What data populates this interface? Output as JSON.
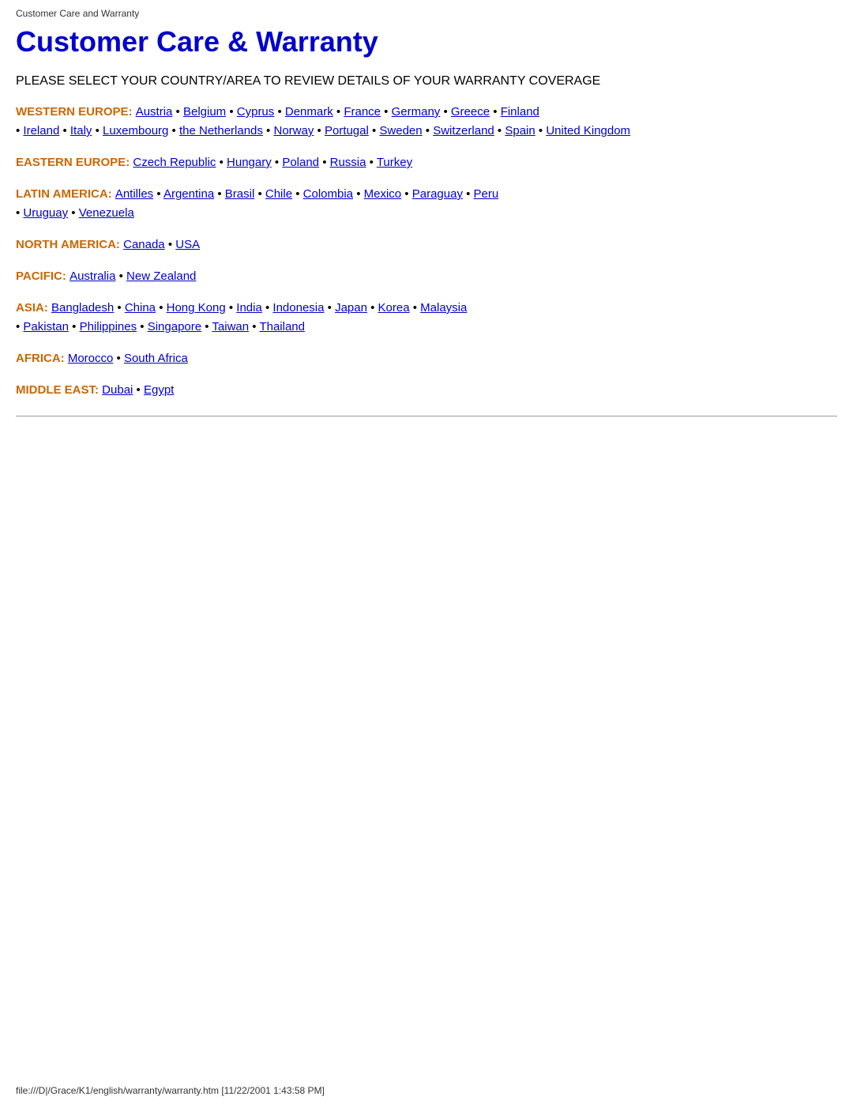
{
  "browser_tab": "Customer Care and Warranty",
  "page_title": "Customer Care & Warranty",
  "subtitle": "PLEASE SELECT YOUR COUNTRY/AREA TO REVIEW DETAILS OF YOUR WARRANTY COVERAGE",
  "regions": [
    {
      "id": "western-europe",
      "label": "WESTERN EUROPE:",
      "countries": [
        "Austria",
        "Belgium",
        "Cyprus",
        "Denmark",
        "France",
        "Germany",
        "Greece",
        "Finland",
        "Ireland",
        "Italy",
        "Luxembourg",
        "the Netherlands",
        "Norway",
        "Portugal",
        "Sweden",
        "Switzerland",
        "Spain",
        "United Kingdom"
      ]
    },
    {
      "id": "eastern-europe",
      "label": "EASTERN EUROPE:",
      "countries": [
        "Czech Republic",
        "Hungary",
        "Poland",
        "Russia",
        "Turkey"
      ]
    },
    {
      "id": "latin-america",
      "label": "LATIN AMERICA:",
      "countries": [
        "Antilles",
        "Argentina",
        "Brasil",
        "Chile",
        "Colombia",
        "Mexico",
        "Paraguay",
        "Peru",
        "Uruguay",
        "Venezuela"
      ]
    },
    {
      "id": "north-america",
      "label": "NORTH AMERICA:",
      "countries": [
        "Canada",
        "USA"
      ]
    },
    {
      "id": "pacific",
      "label": "PACIFIC:",
      "countries": [
        "Australia",
        "New Zealand"
      ]
    },
    {
      "id": "asia",
      "label": "ASIA:",
      "countries": [
        "Bangladesh",
        "China",
        "Hong Kong",
        "India",
        "Indonesia",
        "Japan",
        "Korea",
        "Malaysia",
        "Pakistan",
        "Philippines",
        "Singapore",
        "Taiwan",
        "Thailand"
      ]
    },
    {
      "id": "africa",
      "label": "AFRICA:",
      "countries": [
        "Morocco",
        "South Africa"
      ]
    },
    {
      "id": "middle-east",
      "label": "MIDDLE EAST:",
      "countries": [
        "Dubai",
        "Egypt"
      ]
    }
  ],
  "footer": "file:///D|/Grace/K1/english/warranty/warranty.htm [11/22/2001 1:43:58 PM]"
}
